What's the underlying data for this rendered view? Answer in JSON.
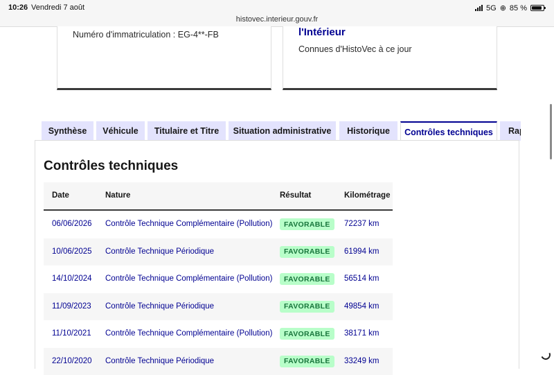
{
  "status_bar": {
    "time": "10:26",
    "date": "Vendredi 7 août",
    "network": "5G",
    "battery": "85 %",
    "battery_level": 0.85
  },
  "browser": {
    "url": "histovec.interieur.gouv.fr"
  },
  "cards": {
    "left": {
      "plate": "Numéro d'immatriculation : EG-4**-FB"
    },
    "right": {
      "title": "l'Intérieur",
      "subtitle": "Connues d'HistoVec à ce jour"
    }
  },
  "tabs": [
    {
      "label": "Synthèse"
    },
    {
      "label": "Véhicule"
    },
    {
      "label": "Titulaire et Titre"
    },
    {
      "label": "Situation administrative"
    },
    {
      "label": "Historique"
    },
    {
      "label": "Contrôles techniques",
      "active": true
    },
    {
      "label": "Rap"
    }
  ],
  "section": {
    "title": "Contrôles techniques",
    "columns": [
      "Date",
      "Nature",
      "Résultat",
      "Kilométrage"
    ],
    "rows": [
      {
        "date": "06/06/2026",
        "nature": "Contrôle Technique Complémentaire (Pollution)",
        "result": "FAVORABLE",
        "km": "72237 km"
      },
      {
        "date": "10/06/2025",
        "nature": "Contrôle Technique Périodique",
        "result": "FAVORABLE",
        "km": "61994 km"
      },
      {
        "date": "14/10/2024",
        "nature": "Contrôle Technique Complémentaire (Pollution)",
        "result": "FAVORABLE",
        "km": "56514 km"
      },
      {
        "date": "11/09/2023",
        "nature": "Contrôle Technique Périodique",
        "result": "FAVORABLE",
        "km": "49854 km"
      },
      {
        "date": "11/10/2021",
        "nature": "Contrôle Technique Complémentaire (Pollution)",
        "result": "FAVORABLE",
        "km": "38171 km"
      },
      {
        "date": "22/10/2020",
        "nature": "Contrôle Technique Périodique",
        "result": "FAVORABLE",
        "km": "33249 km"
      }
    ]
  },
  "colors": {
    "accent": "#000091",
    "tab_bg": "#e3e3fd",
    "badge_bg": "#b8fec9",
    "badge_text": "#18753c"
  }
}
